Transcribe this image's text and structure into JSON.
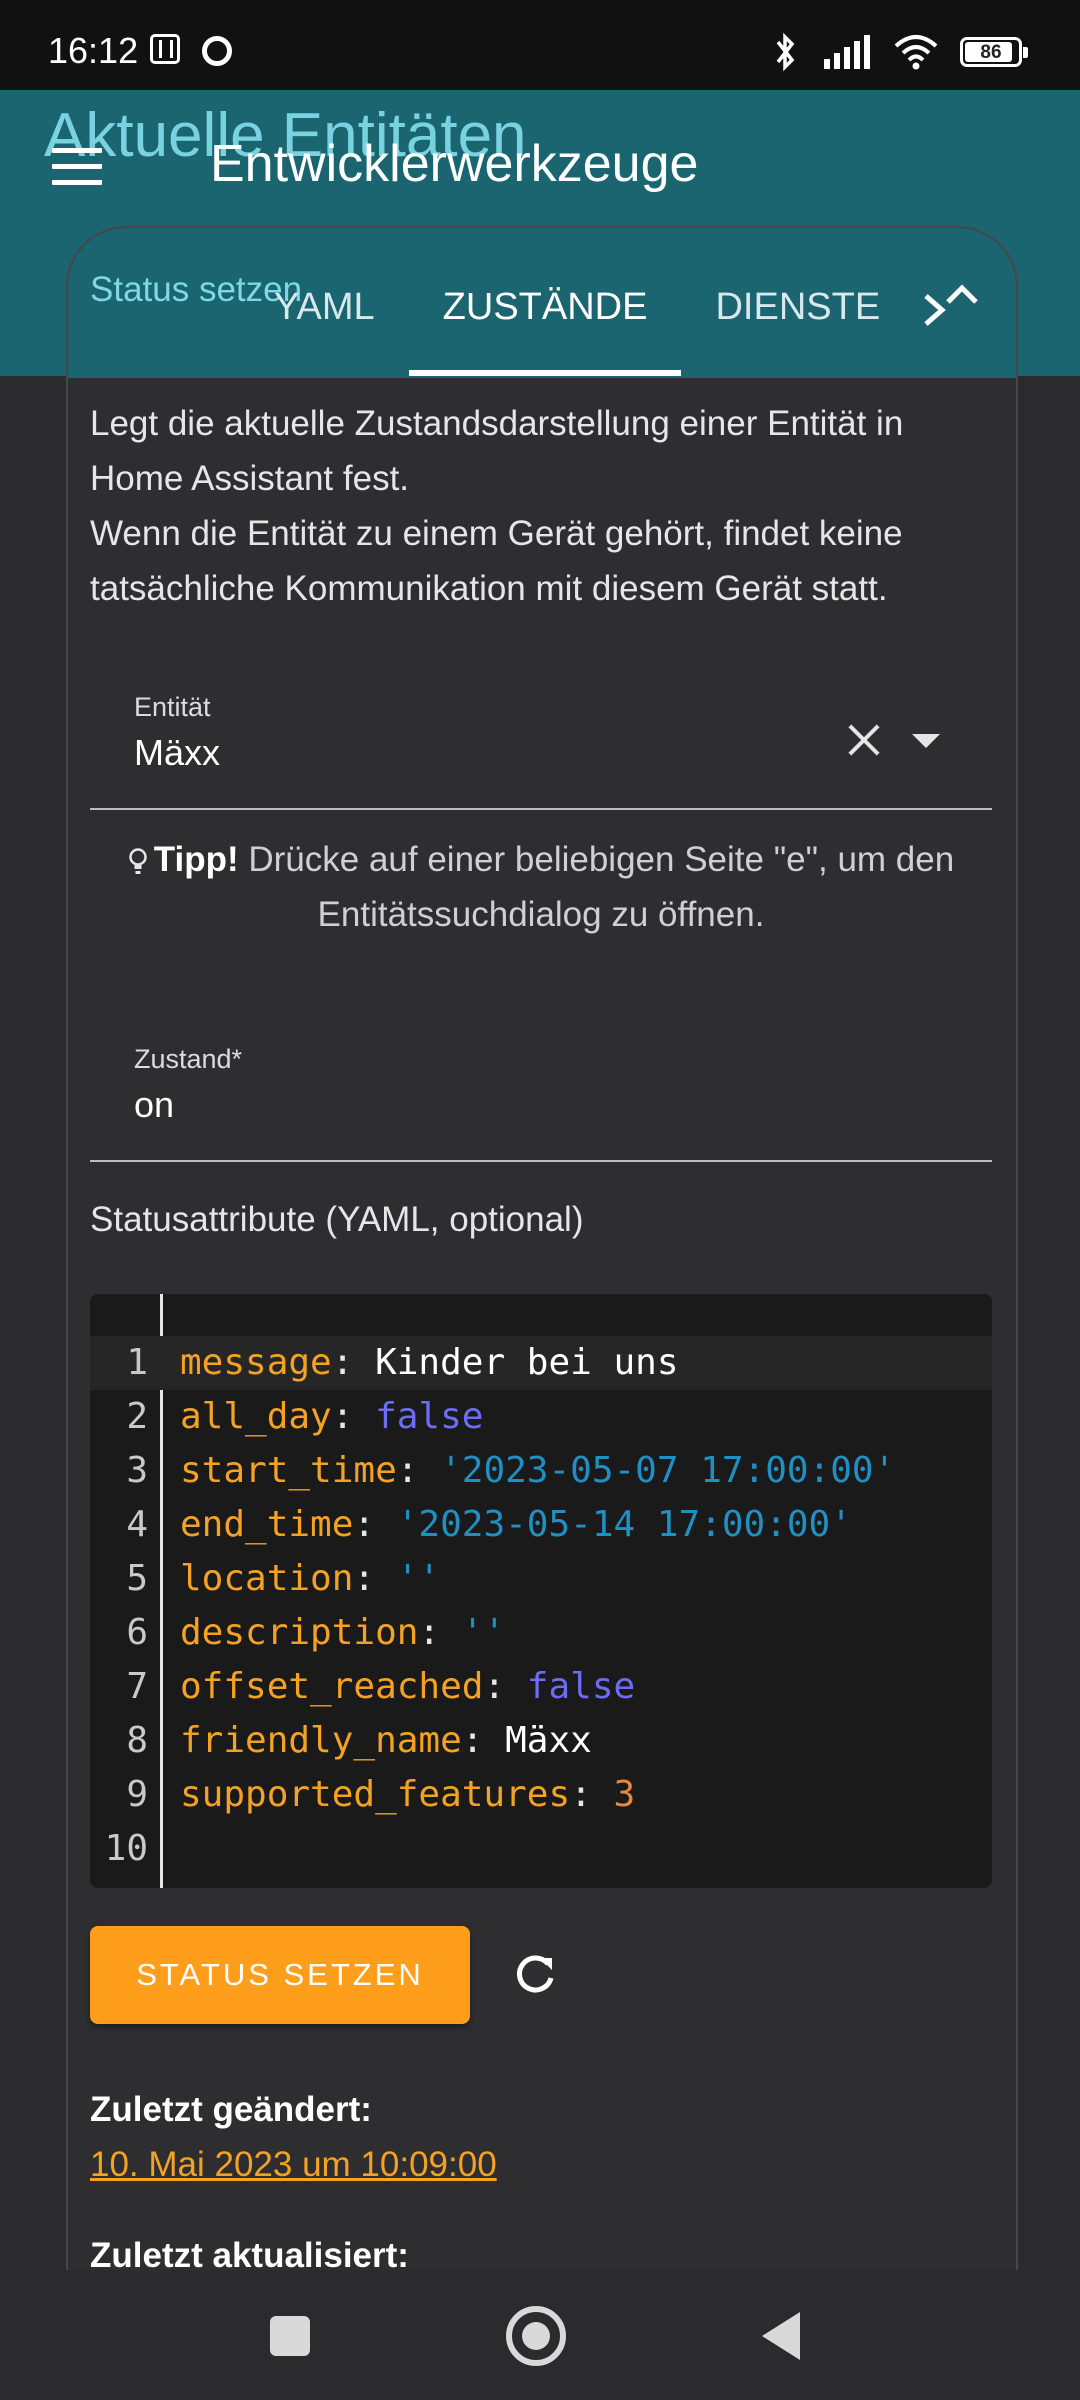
{
  "status_bar": {
    "time": "16:12",
    "battery": "86"
  },
  "app": {
    "ghost_title": "Aktuelle Entitäten",
    "title": "Entwicklerwerkzeuge",
    "ghost_subtitle": "Status setzen",
    "tabs": [
      "YAML",
      "ZUSTÄNDE",
      "DIENSTE"
    ],
    "active_tab": "ZUSTÄNDE"
  },
  "form": {
    "description_line1": "Legt die aktuelle Zustandsdarstellung einer Entität in Home Assistant fest.",
    "description_line2": "Wenn die Entität zu einem Gerät gehört, findet keine tatsächliche Kommunikation mit diesem Gerät statt.",
    "entity_label": "Entität",
    "entity_value": "Mäxx",
    "tip_bold": "Tipp!",
    "tip_text": " Drücke auf einer beliebigen Seite \"e\", um den Entitätssuchdialog zu öffnen.",
    "state_label": "Zustand*",
    "state_value": "on",
    "attributes_label": "Statusattribute (YAML, optional)"
  },
  "editor": {
    "lines": [
      {
        "n": "1",
        "key": "message",
        "value": "Kinder bei uns",
        "type": "s"
      },
      {
        "n": "2",
        "key": "all_day",
        "value": "false",
        "type": "b"
      },
      {
        "n": "3",
        "key": "start_time",
        "value": "'2023-05-07 17:00:00'",
        "type": "q"
      },
      {
        "n": "4",
        "key": "end_time",
        "value": "'2023-05-14 17:00:00'",
        "type": "q"
      },
      {
        "n": "5",
        "key": "location",
        "value": "''",
        "type": "q"
      },
      {
        "n": "6",
        "key": "description",
        "value": "''",
        "type": "q"
      },
      {
        "n": "7",
        "key": "offset_reached",
        "value": "false",
        "type": "b"
      },
      {
        "n": "8",
        "key": "friendly_name",
        "value": "Mäxx",
        "type": "s"
      },
      {
        "n": "9",
        "key": "supported_features",
        "value": "3",
        "type": "n"
      },
      {
        "n": "10",
        "key": "",
        "value": "",
        "type": "s"
      }
    ]
  },
  "actions": {
    "set_state_label": "STATUS SETZEN"
  },
  "meta": {
    "last_changed_label": "Zuletzt geändert:",
    "last_changed_value": "10. Mai 2023 um 10:09:00",
    "last_updated_label": "Zuletzt aktualisiert:"
  },
  "colors": {
    "header": "#1a6570",
    "accent": "#ff9e1b",
    "background": "#2b2b2d"
  }
}
